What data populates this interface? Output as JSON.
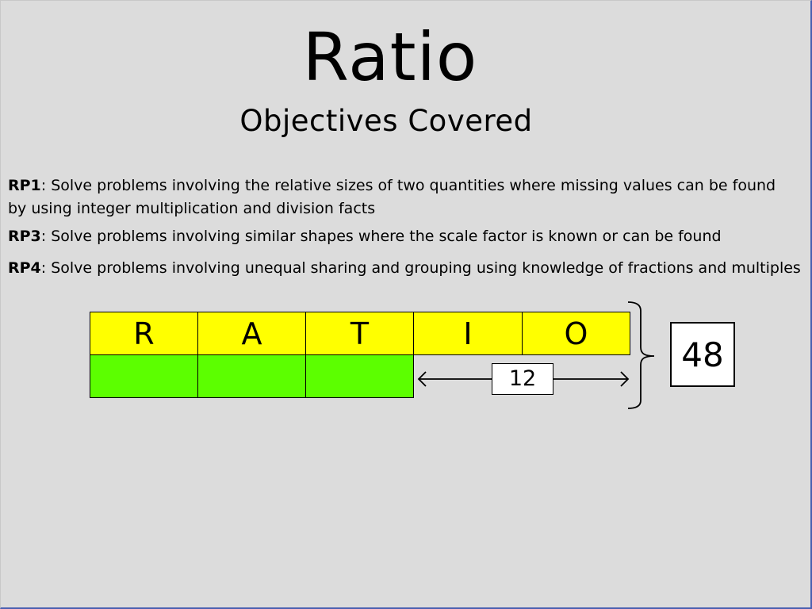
{
  "title": "Ratio",
  "subtitle": "Objectives Covered",
  "objectives": [
    {
      "code": "RP1",
      "text_line1": ": Solve problems involving the relative sizes of two quantities where missing values can be found",
      "text_line2": "by using integer multiplication and division facts"
    },
    {
      "code": "RP3",
      "text": ": Solve problems involving similar shapes where the scale factor is known or can be found"
    },
    {
      "code": "RP4",
      "text": ": Solve problems involving unequal sharing and grouping using knowledge of fractions and multiples"
    }
  ],
  "bar_model": {
    "top_row_letters": [
      "R",
      "A",
      "T",
      "I",
      "O"
    ],
    "top_row_color": "#ffff00",
    "bottom_row_filled_parts": 3,
    "bottom_row_color": "#5cff00",
    "remainder_label": "12",
    "total_label": "48"
  }
}
